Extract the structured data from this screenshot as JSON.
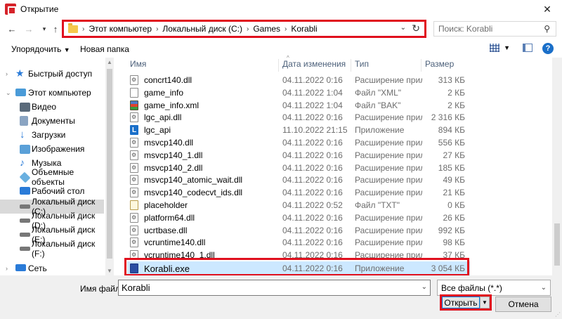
{
  "window": {
    "title": "Открытие"
  },
  "address": {
    "crumbs": [
      "Этот компьютер",
      "Локальный диск (C:)",
      "Games",
      "Korabli"
    ]
  },
  "search": {
    "placeholder": "Поиск: Korabli"
  },
  "toolbar": {
    "organize": "Упорядочить",
    "new_folder": "Новая папка"
  },
  "sidebar": {
    "items": [
      {
        "label": "Быстрый доступ",
        "icon": "star-icon",
        "color": "#2a7bd8"
      },
      {
        "label": "Этот компьютер",
        "icon": "computer-icon",
        "color": "#4a9bd8"
      },
      {
        "label": "Видео",
        "icon": "video-icon",
        "color": "#5a6a7a"
      },
      {
        "label": "Документы",
        "icon": "documents-icon",
        "color": "#8aa4c2"
      },
      {
        "label": "Загрузки",
        "icon": "downloads-icon",
        "color": "#2a7bd8"
      },
      {
        "label": "Изображения",
        "icon": "pictures-icon",
        "color": "#5aa0d8"
      },
      {
        "label": "Музыка",
        "icon": "music-icon",
        "color": "#2a7bd8"
      },
      {
        "label": "Объемные объекты",
        "icon": "3d-objects-icon",
        "color": "#6ab0e0"
      },
      {
        "label": "Рабочий стол",
        "icon": "desktop-icon",
        "color": "#2a7bd8"
      },
      {
        "label": "Локальный диск (C:)",
        "icon": "drive-icon",
        "color": "#777777"
      },
      {
        "label": "Локальный диск (D:)",
        "icon": "drive-icon",
        "color": "#777777"
      },
      {
        "label": "Локальный диск (E:)",
        "icon": "drive-icon",
        "color": "#777777"
      },
      {
        "label": "Локальный диск (F:)",
        "icon": "drive-icon",
        "color": "#777777"
      },
      {
        "label": "Сеть",
        "icon": "network-icon",
        "color": "#2a7bd8"
      }
    ]
  },
  "columns": {
    "name": "Имя",
    "date": "Дата изменения",
    "type": "Тип",
    "size": "Размер"
  },
  "files": [
    {
      "name": "concrt140.dll",
      "date": "04.11.2022 0:16",
      "type": "Расширение приложения",
      "size": "313 КБ",
      "icon": "dll"
    },
    {
      "name": "game_info",
      "date": "04.11.2022 1:04",
      "type": "Файл \"XML\"",
      "size": "2 КБ",
      "icon": "xml"
    },
    {
      "name": "game_info.xml",
      "date": "04.11.2022 1:04",
      "type": "Файл \"BAK\"",
      "size": "2 КБ",
      "icon": "bak"
    },
    {
      "name": "lgc_api.dll",
      "date": "04.11.2022 0:16",
      "type": "Расширение приложения",
      "size": "2 316 КБ",
      "icon": "dll"
    },
    {
      "name": "lgc_api",
      "date": "11.10.2022 21:15",
      "type": "Приложение",
      "size": "894 КБ",
      "icon": "app"
    },
    {
      "name": "msvcp140.dll",
      "date": "04.11.2022 0:16",
      "type": "Расширение приложения",
      "size": "556 КБ",
      "icon": "dll"
    },
    {
      "name": "msvcp140_1.dll",
      "date": "04.11.2022 0:16",
      "type": "Расширение приложения",
      "size": "27 КБ",
      "icon": "dll"
    },
    {
      "name": "msvcp140_2.dll",
      "date": "04.11.2022 0:16",
      "type": "Расширение приложения",
      "size": "185 КБ",
      "icon": "dll"
    },
    {
      "name": "msvcp140_atomic_wait.dll",
      "date": "04.11.2022 0:16",
      "type": "Расширение приложения",
      "size": "49 КБ",
      "icon": "dll"
    },
    {
      "name": "msvcp140_codecvt_ids.dll",
      "date": "04.11.2022 0:16",
      "type": "Расширение приложения",
      "size": "21 КБ",
      "icon": "dll"
    },
    {
      "name": "placeholder",
      "date": "04.11.2022 0:52",
      "type": "Файл \"TXT\"",
      "size": "0 КБ",
      "icon": "txt"
    },
    {
      "name": "platform64.dll",
      "date": "04.11.2022 0:16",
      "type": "Расширение приложения",
      "size": "26 КБ",
      "icon": "dll"
    },
    {
      "name": "ucrtbase.dll",
      "date": "04.11.2022 0:16",
      "type": "Расширение приложения",
      "size": "992 КБ",
      "icon": "dll"
    },
    {
      "name": "vcruntime140.dll",
      "date": "04.11.2022 0:16",
      "type": "Расширение приложения",
      "size": "98 КБ",
      "icon": "dll"
    },
    {
      "name": "vcruntime140_1.dll",
      "date": "04.11.2022 0:16",
      "type": "Расширение приложения",
      "size": "37 КБ",
      "icon": "dll"
    },
    {
      "name": "Korabli.exe",
      "date": "04.11.2022 0:16",
      "type": "Приложение",
      "size": "3 054 КБ",
      "icon": "exe",
      "selected": true
    }
  ],
  "bottom": {
    "filename_label": "Имя файла:",
    "filename_value": "Korabli",
    "filter": "Все файлы (*.*)",
    "open": "Открыть",
    "cancel": "Отмена"
  },
  "colors": {
    "highlight": "#e0101e",
    "selection": "#cce8ff"
  }
}
